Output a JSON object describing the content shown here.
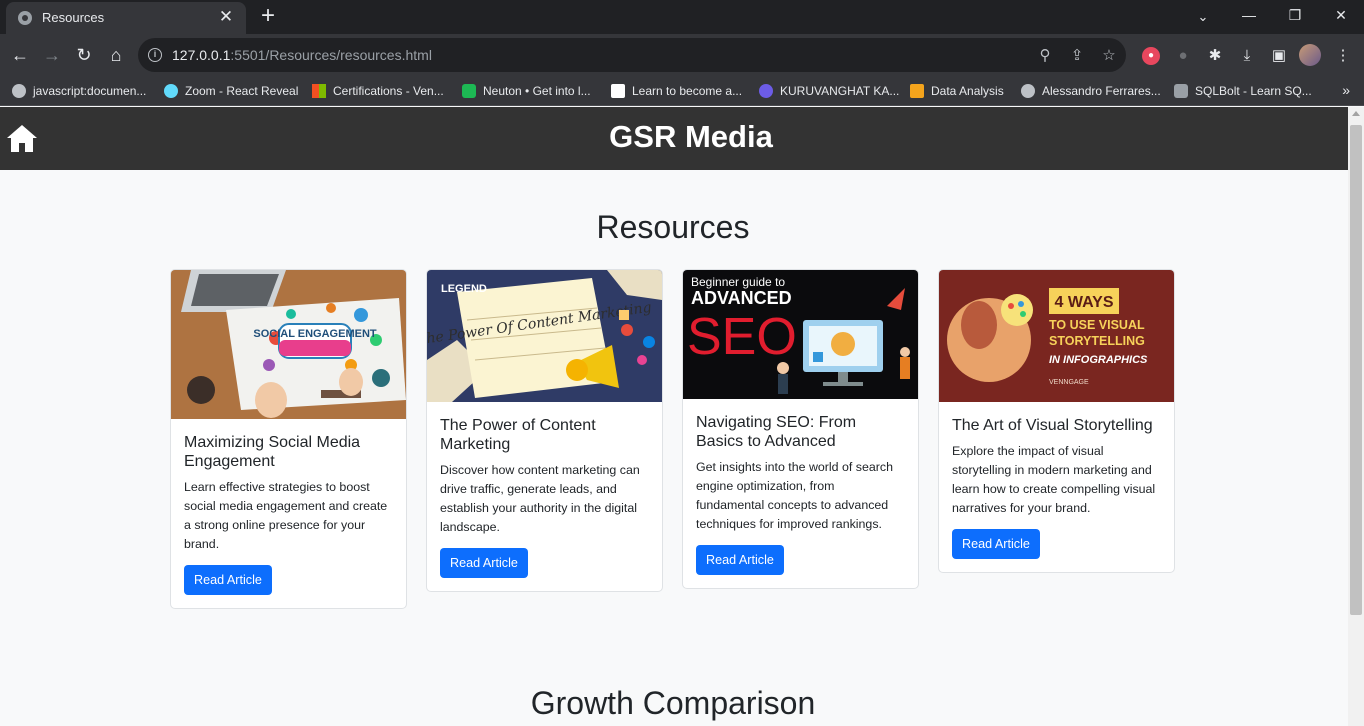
{
  "browser": {
    "tab_title": "Resources",
    "url_host": "127.0.0.1",
    "url_rest": ":5501/Resources/resources.html",
    "bookmarks": [
      "javascript:documen...",
      "Zoom - React Reveal",
      "Certifications - Ven...",
      "Neuton • Get into l...",
      "Learn to become a...",
      "KURUVANGHAT KA...",
      "Data Analysis",
      "Alessandro Ferrares...",
      "SQLBolt - Learn SQ..."
    ]
  },
  "site": {
    "title": "GSR Media"
  },
  "resources": {
    "heading": "Resources",
    "cards": [
      {
        "title": "Maximizing Social Media Engagement",
        "text": "Learn effective strategies to boost social media engagement and create a strong online presence for your brand.",
        "button": "Read Article",
        "image_text": "SOCIAL ENGAGEMENT"
      },
      {
        "title": "The Power of Content Marketing",
        "text": "Discover how content marketing can drive traffic, generate leads, and establish your authority in the digital landscape.",
        "button": "Read Article",
        "image_text": "The Power Of Content Marketing",
        "image_logo": "LEGEND"
      },
      {
        "title": "Navigating SEO: From Basics to Advanced",
        "text": "Get insights into the world of search engine optimization, from fundamental concepts to advanced techniques for improved rankings.",
        "button": "Read Article",
        "image_small": "Beginner guide to",
        "image_big": "ADVANCED",
        "image_seo": "SEO"
      },
      {
        "title": "The Art of Visual Storytelling",
        "text": "Explore the impact of visual storytelling in modern marketing and learn how to create compelling visual narratives for your brand.",
        "button": "Read Article",
        "image_badge": "4 WAYS",
        "image_line1": "TO USE VISUAL",
        "image_line2": "STORYTELLING",
        "image_line3": "IN INFOGRAPHICS",
        "image_brand": "VENNGAGE"
      }
    ]
  },
  "growth": {
    "heading": "Growth Comparison"
  },
  "colors": {
    "header_bg": "#333333",
    "button_bg": "#0d6efd",
    "page_bg": "#f8f9fa"
  }
}
